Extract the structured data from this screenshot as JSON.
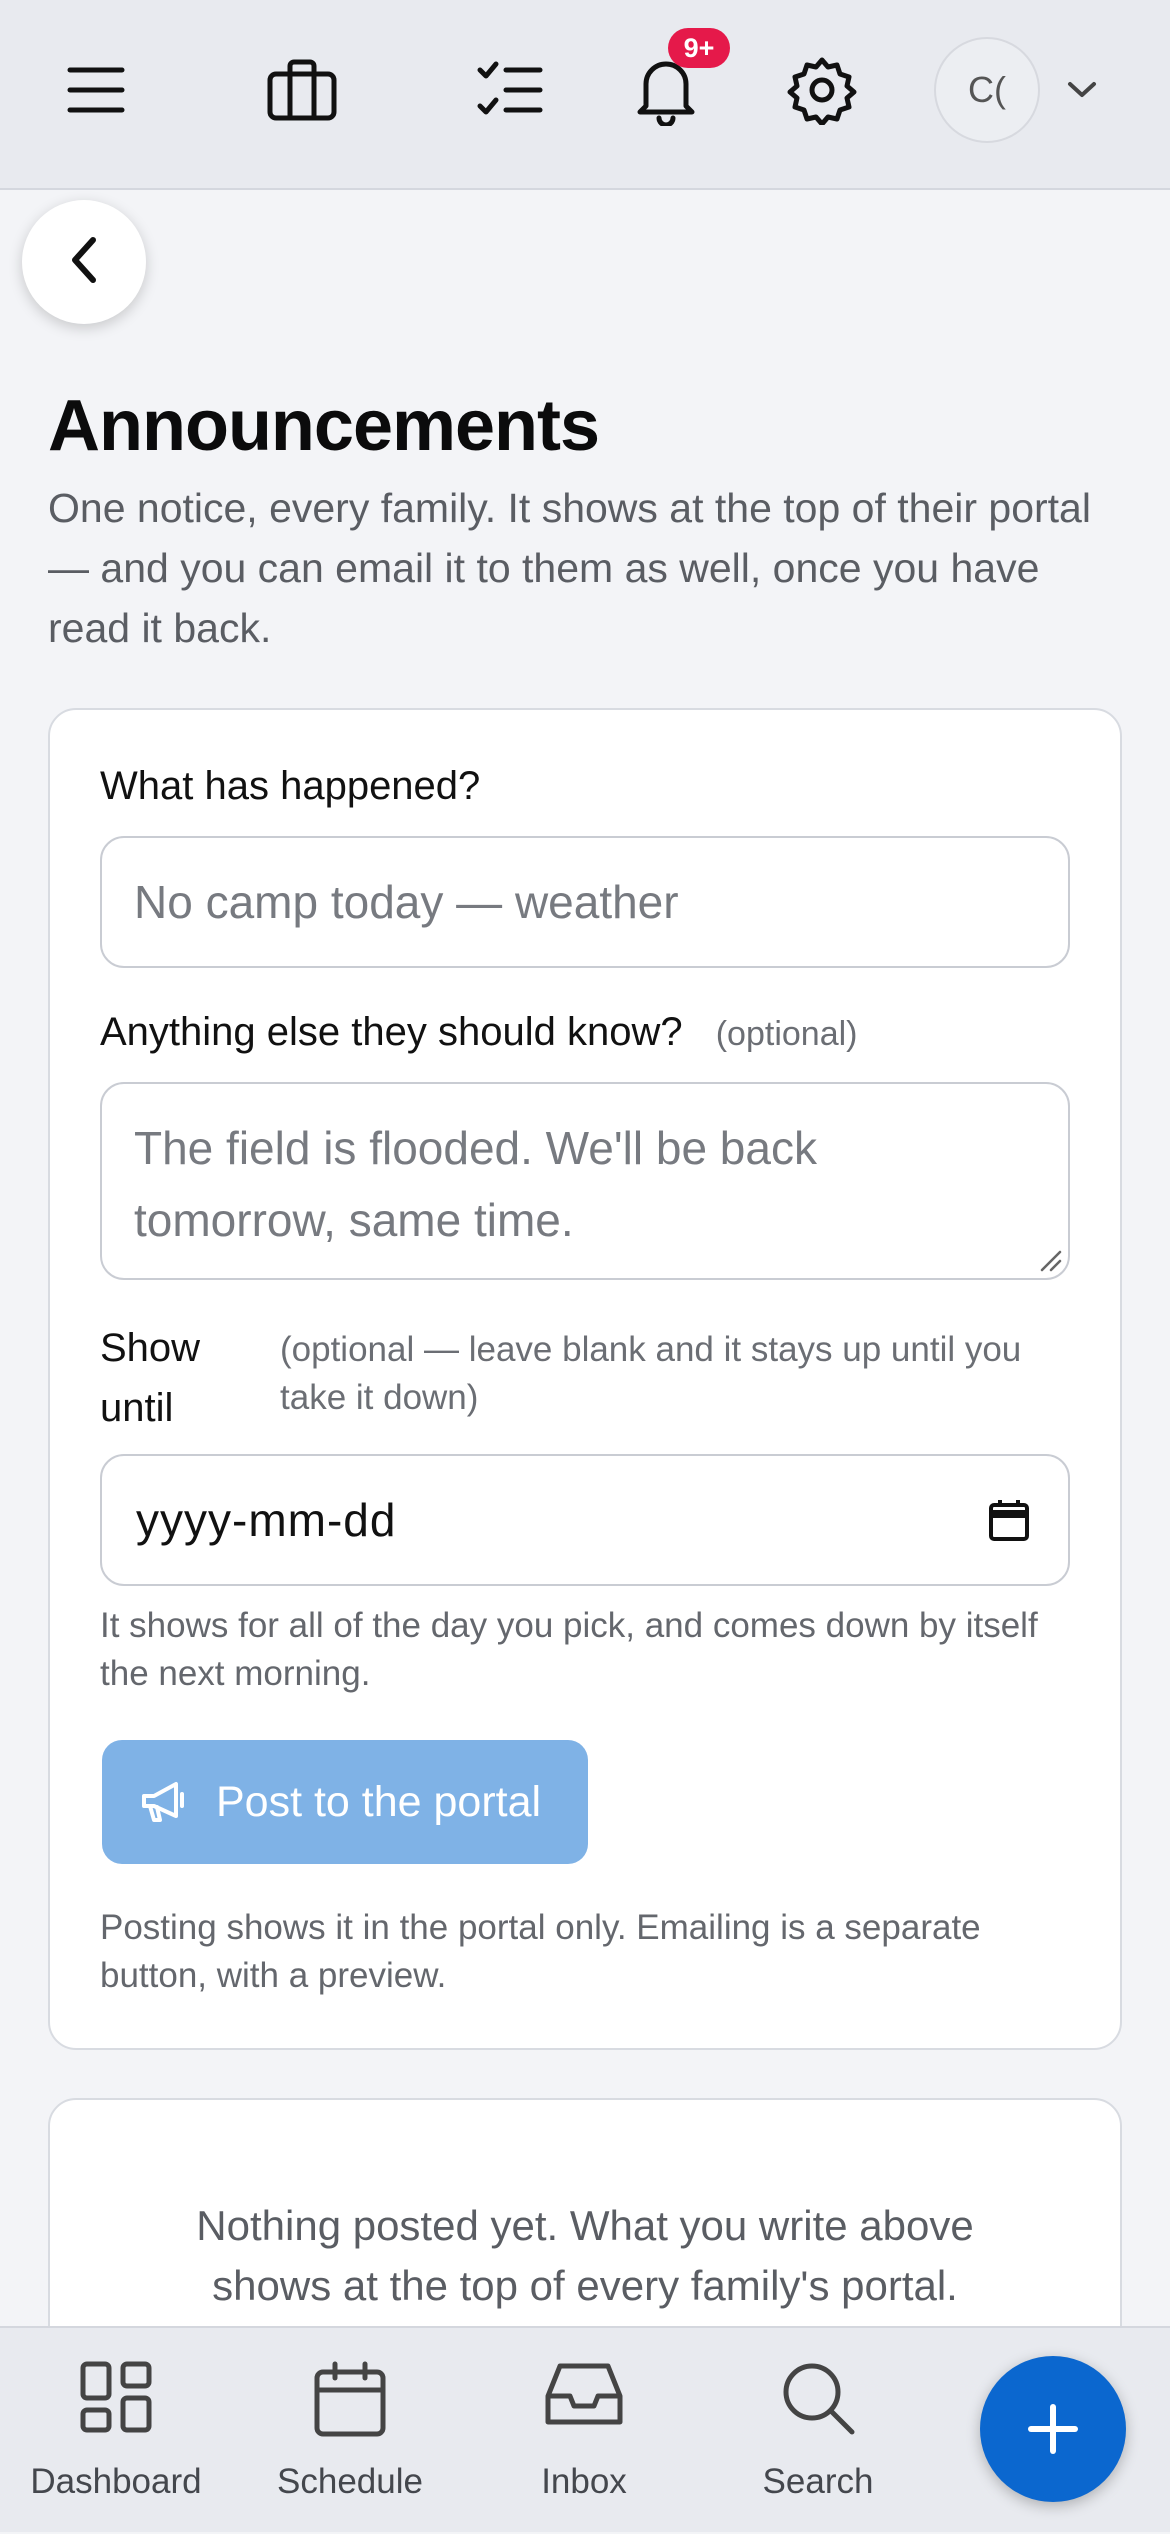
{
  "topbar": {
    "notification_badge": "9+",
    "avatar_initials": "C(",
    "icons": [
      "menu-icon",
      "briefcase-icon",
      "checklist-icon",
      "bell-icon",
      "gear-icon",
      "chevron-down-icon"
    ]
  },
  "page": {
    "title": "Announcements",
    "subtitle": "One notice, every family. It shows at the top of their portal — and you can email it to them as well, once you have read it back."
  },
  "form": {
    "headline_label": "What has happened?",
    "headline_placeholder": "No camp today — weather",
    "details_label": "Anything else they should know?",
    "details_optional": "(optional)",
    "details_placeholder": "The field is flooded. We'll be back tomorrow, same time.",
    "show_until_label": "Show until",
    "show_until_note": "(optional — leave blank and it stays up until you take it down)",
    "date_placeholder": "yyyy-mm-dd",
    "date_help": "It shows for all of the day you pick, and comes down by itself the next morning.",
    "post_button": "Post to the portal",
    "post_note": "Posting shows it in the portal only. Emailing is a separate button, with a preview."
  },
  "empty_state": {
    "message": "Nothing posted yet. What you write above shows at the top of every family's portal."
  },
  "bottom_nav": {
    "items": [
      {
        "label": "Dashboard",
        "icon": "dashboard-icon"
      },
      {
        "label": "Schedule",
        "icon": "calendar-icon"
      },
      {
        "label": "Inbox",
        "icon": "inbox-icon"
      },
      {
        "label": "Search",
        "icon": "search-icon"
      }
    ],
    "fab_icon": "plus-icon"
  },
  "colors": {
    "accent": "#0b67cf",
    "button_disabled": "#7fb2e6",
    "badge": "#e5194a"
  }
}
